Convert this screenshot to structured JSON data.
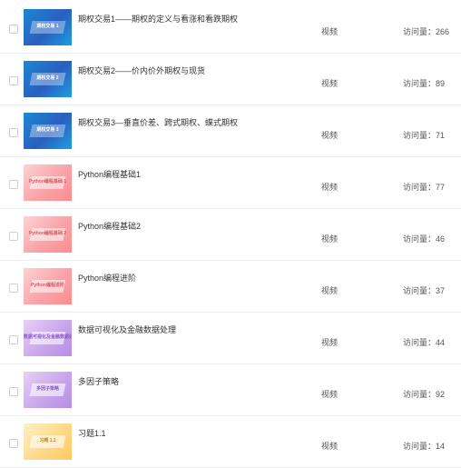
{
  "items": [
    {
      "title": "期权交易1——期权的定义与看涨和看跌期权",
      "type": "视频",
      "views": "访问量：266",
      "thumb_text": "期权交易 1",
      "thumb_color": "blue"
    },
    {
      "title": "期权交易2——价内价外期权与现货",
      "type": "视频",
      "views": "访问量：89",
      "thumb_text": "期权交易 2",
      "thumb_color": "blue"
    },
    {
      "title": "期权交易3—垂直价差、跨式期权、蝶式期权",
      "type": "视频",
      "views": "访问量：71",
      "thumb_text": "期权交易 3",
      "thumb_color": "blue"
    },
    {
      "title": "Python编程基础1",
      "type": "视频",
      "views": "访问量：77",
      "thumb_text": "Python编程基础 1",
      "thumb_color": "pink"
    },
    {
      "title": "Python编程基础2",
      "type": "视频",
      "views": "访问量：46",
      "thumb_text": "Python编程基础 2",
      "thumb_color": "pink"
    },
    {
      "title": "Python编程进阶",
      "type": "视频",
      "views": "访问量：37",
      "thumb_text": "Python编程进阶",
      "thumb_color": "pink"
    },
    {
      "title": "数据可视化及金融数据处理",
      "type": "视频",
      "views": "访问量：44",
      "thumb_text": "数据可视化及金融数据处理",
      "thumb_color": "purple"
    },
    {
      "title": "多因子策略",
      "type": "视频",
      "views": "访问量：92",
      "thumb_text": "多因子策略",
      "thumb_color": "purple"
    },
    {
      "title": "习题1.1",
      "type": "视频",
      "views": "访问量：14",
      "thumb_text": "习题 1.1",
      "thumb_color": "yellow"
    }
  ]
}
